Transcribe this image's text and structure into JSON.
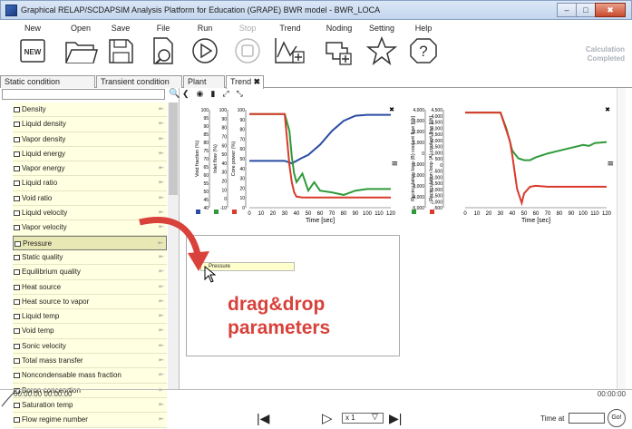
{
  "window": {
    "title": "Graphical RELAP/SCDAPSIM Analysis Platform for Education (GRAPE) BWR model - BWR_LOCA",
    "minimize": "–",
    "maximize": "□",
    "close": "✖"
  },
  "toolbar": {
    "new": "New",
    "new_icon_text": "NEW",
    "open": "Open",
    "save": "Save",
    "file": "File",
    "run": "Run",
    "stop": "Stop",
    "trend": "Trend",
    "noding": "Noding",
    "setting": "Setting",
    "help": "Help",
    "status_line1": "Calculation",
    "status_line2": "Completed"
  },
  "tabs": [
    {
      "label": "Static condition"
    },
    {
      "label": "Transient condition"
    },
    {
      "label": "Plant"
    },
    {
      "label": "Trend"
    }
  ],
  "tab_close": "✖",
  "sidebar": {
    "search_placeholder": "",
    "items": [
      {
        "label": "Density"
      },
      {
        "label": "Liquid density"
      },
      {
        "label": "Vapor density"
      },
      {
        "label": "Liquid energy"
      },
      {
        "label": "Vapor energy"
      },
      {
        "label": "Liquid ratio"
      },
      {
        "label": "Void ratio"
      },
      {
        "label": "Liquid velocity"
      },
      {
        "label": "Vapor velocity"
      },
      {
        "label": "Pressure"
      },
      {
        "label": "Static quality"
      },
      {
        "label": "Equilibrium quality"
      },
      {
        "label": "Heat source"
      },
      {
        "label": "Heat source to vapor"
      },
      {
        "label": "Liquid temp"
      },
      {
        "label": "Void temp"
      },
      {
        "label": "Sonic velocity"
      },
      {
        "label": "Total mass transfer"
      },
      {
        "label": "Noncondensable mass fraction"
      },
      {
        "label": "Boron concenrtion"
      },
      {
        "label": "Saturation temp"
      },
      {
        "label": "Flow regime number"
      }
    ]
  },
  "drag_chip": "Pressure",
  "drag_drop_text": [
    "drag&drop",
    "parameters"
  ],
  "chart_data": [
    {
      "type": "line",
      "xlabel": "Time [sec]",
      "x_ticks": [
        "0",
        "10",
        "20",
        "30",
        "40",
        "50",
        "60",
        "70",
        "80",
        "90",
        "100",
        "110",
        "120"
      ],
      "axes": [
        {
          "label": "Void fraction (%)",
          "ticks": [
            "40",
            "45",
            "50",
            "55",
            "60",
            "65",
            "70",
            "75",
            "80",
            "85",
            "90",
            "95",
            "100"
          ],
          "color": "#2a4da3"
        },
        {
          "label": "Inlet flow (%)",
          "ticks": [
            "-10",
            "0",
            "10",
            "20",
            "30",
            "40",
            "50",
            "60",
            "70",
            "80",
            "90",
            "100"
          ],
          "color": "#2f9a3a"
        },
        {
          "label": "Core power (%)",
          "ticks": [
            "0",
            "10",
            "20",
            "30",
            "40",
            "50",
            "60",
            "70",
            "80",
            "90",
            "100"
          ],
          "color": "#d93a2b"
        }
      ],
      "series": [
        {
          "color": "#2a4da3",
          "x": [
            0,
            10,
            20,
            30,
            36,
            40,
            44,
            50,
            55,
            60,
            70,
            80,
            90,
            100,
            110,
            120
          ],
          "y": [
            45,
            45,
            45,
            45,
            42,
            45,
            48,
            52,
            58,
            64,
            80,
            92,
            98,
            99,
            99,
            99
          ]
        },
        {
          "color": "#2f9a3a",
          "x": [
            0,
            10,
            20,
            30,
            34,
            36,
            38,
            40,
            45,
            50,
            55,
            60,
            70,
            80,
            90,
            100,
            110,
            120
          ],
          "y": [
            100,
            100,
            100,
            100,
            80,
            50,
            30,
            20,
            30,
            10,
            20,
            10,
            8,
            5,
            10,
            12,
            12,
            12
          ]
        },
        {
          "color": "#d93a2b",
          "x": [
            0,
            10,
            20,
            30,
            32,
            34,
            36,
            38,
            40,
            45,
            50,
            60,
            80,
            100,
            120
          ],
          "y": [
            100,
            100,
            100,
            100,
            70,
            40,
            20,
            8,
            3,
            2,
            2,
            2,
            2,
            2,
            2
          ]
        }
      ]
    },
    {
      "type": "line",
      "xlabel": "Time [sec]",
      "x_ticks": [
        "0",
        "10",
        "20",
        "30",
        "40",
        "50",
        "60",
        "70",
        "80",
        "90",
        "100",
        "110",
        "120"
      ],
      "axes": [
        {
          "label": "Recirculation loop (B) coolant flow [t/h]",
          "ticks": [
            "-5,000",
            "-4,000",
            "-3,000",
            "-2,000",
            "-1,000",
            "0",
            "1,000",
            "2,000",
            "3,000",
            "4,000"
          ],
          "color": "#2f9a3a"
        },
        {
          "label": "Recirculation loop (A) coolant flow [t/h]",
          "ticks": [
            "-500",
            "-1,000",
            "-1,500",
            "-2,000",
            "-1,500",
            "-1,000",
            "-500",
            "0",
            "500",
            "1,000",
            "1,500",
            "2,000",
            "2,500",
            "3,000",
            "3,500",
            "4,000",
            "4,500"
          ],
          "color": "#d93a2b"
        }
      ],
      "series": [
        {
          "color": "#2f9a3a",
          "x": [
            0,
            10,
            20,
            30,
            35,
            40,
            45,
            50,
            55,
            60,
            70,
            80,
            90,
            100,
            105,
            110,
            120
          ],
          "y": [
            4500,
            4500,
            4500,
            4500,
            2800,
            500,
            -300,
            -500,
            -500,
            -200,
            200,
            500,
            800,
            1100,
            1000,
            1300,
            1400
          ]
        },
        {
          "color": "#d93a2b",
          "x": [
            0,
            10,
            20,
            30,
            34,
            38,
            40,
            44,
            48,
            50,
            55,
            60,
            70,
            80,
            100,
            120
          ],
          "y": [
            4500,
            4500,
            4500,
            4500,
            3000,
            1500,
            0,
            -3500,
            -5000,
            -4000,
            -3300,
            -3200,
            -3300,
            -3300,
            -3300,
            -3300
          ]
        }
      ]
    }
  ],
  "chart_close": "✖",
  "chart_menu": "≡",
  "timeline": {
    "left": "00:00:00 00:00:00",
    "right": "00:00:00"
  },
  "player": {
    "speed": "x 1",
    "time_at_label": "Time at",
    "go": "Go!"
  }
}
